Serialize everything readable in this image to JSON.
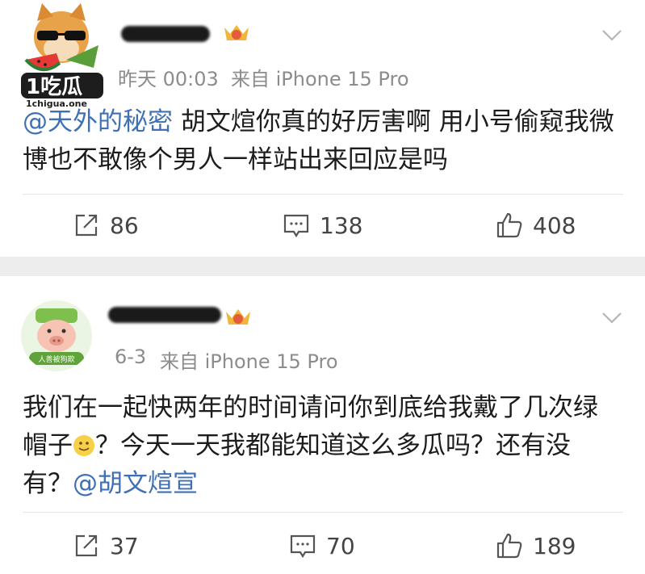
{
  "watermark": {
    "brand": "1吃瓜",
    "site": "1chigua.one"
  },
  "posts": [
    {
      "time": "昨天 00:03",
      "source": "来自 iPhone 15 Pro",
      "mention": "@天外的秘密",
      "text": " 胡文煊你真的好厉害啊 用小号偷窥我微博也不敢像个男人一样站出来回应是吗",
      "reposts": "86",
      "comments": "138",
      "likes": "408"
    },
    {
      "time": "6-3",
      "source": "来自 iPhone 15 Pro",
      "avatar_caption": "人善被狗欺",
      "text_a": "我们在一起快两年的时间请问你到底给我戴了几次绿帽子",
      "text_b": "？今天一天我都能知道这么多瓜吗？还有没有？",
      "mention": "@胡文煊宣",
      "reposts": "37",
      "comments": "70",
      "likes": "189"
    }
  ],
  "icons": {
    "repost": "repost-icon",
    "comment": "comment-icon",
    "like": "like-icon",
    "menu": "chevron-down-icon"
  },
  "colors": {
    "mention": "#3f6fb4",
    "meta": "#8c8c8c",
    "gap": "#ededed"
  }
}
